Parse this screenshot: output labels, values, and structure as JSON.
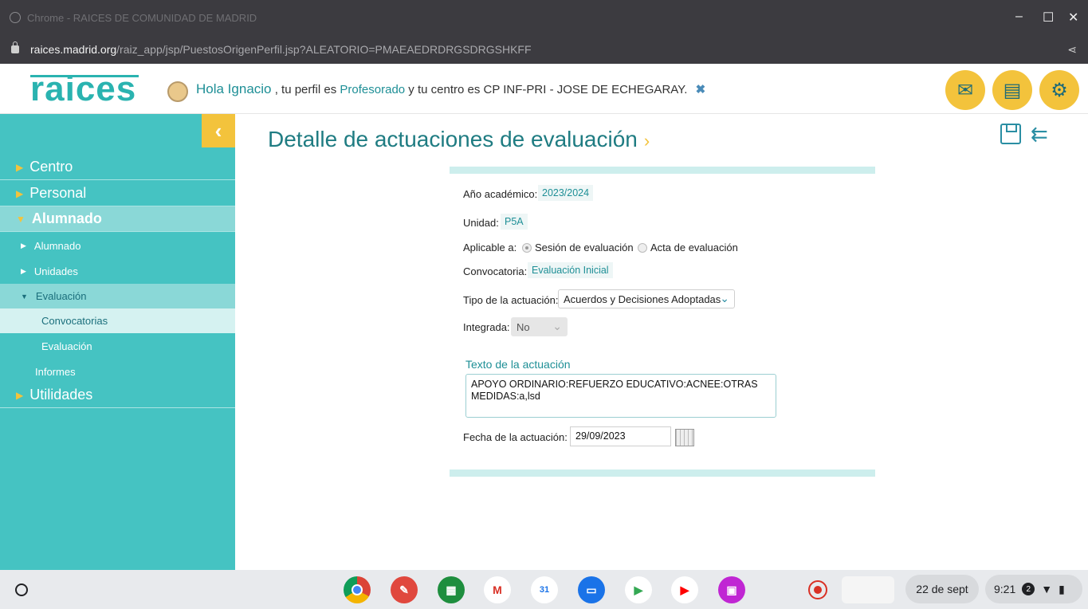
{
  "window": {
    "title": "Chrome - RAICES DE COMUNIDAD DE MADRID",
    "minimize": "–",
    "maximize": "☐",
    "close": "✕"
  },
  "browser": {
    "url_host": "raices.madrid.org",
    "url_path": "/raiz_app/jsp/PuestosOrigenPerfil.jsp?ALEATORIO=PMAEAEDRDRGSDRGSHKFF"
  },
  "header": {
    "logo": "raices",
    "greeting_hola": "Hola Ignacio",
    "greeting_mid": ", tu perfil es",
    "profile": "Profesorado",
    "greeting_centre_prefix": "y tu centro es",
    "centre": "CP INF-PRI - JOSE DE ECHEGARAY.",
    "close_symbol": "✖"
  },
  "sidebar": {
    "collapse_symbol": "‹",
    "items": [
      {
        "label": "Centro"
      },
      {
        "label": "Personal"
      },
      {
        "label": "Alumnado"
      },
      {
        "label": "Alumnado"
      },
      {
        "label": "Unidades"
      },
      {
        "label": "Evaluación"
      },
      {
        "label": "Convocatorias"
      },
      {
        "label": "Evaluación"
      },
      {
        "label": "Informes"
      },
      {
        "label": "Utilidades"
      }
    ]
  },
  "main": {
    "title": "Detalle de actuaciones de evaluación",
    "fields": {
      "anio_label": "Año académico:",
      "anio_value": "2023/2024",
      "unidad_label": "Unidad:",
      "unidad_value": "P5A",
      "aplicable_label": "Aplicable a:",
      "aplicable_opt1": "Sesión de evaluación",
      "aplicable_opt2": "Acta de evaluación",
      "convocatoria_label": "Convocatoria:",
      "convocatoria_value": "Evaluación Inicial",
      "tipo_label": "Tipo de la actuación:",
      "tipo_value": "Acuerdos y Decisiones Adoptadas",
      "integrada_label": "Integrada:",
      "integrada_value": "No",
      "texto_label": "Texto de la actuación",
      "texto_value": "APOYO ORDINARIO:REFUERZO EDUCATIVO:ACNEE:OTRAS MEDIDAS:a,lsd",
      "fecha_label": "Fecha de la actuación:",
      "fecha_value": "29/09/2023"
    }
  },
  "shelf": {
    "date": "22 de sept",
    "time": "9:21",
    "notif_count": "2",
    "apps": [
      "Chrome",
      "Canvas",
      "Classroom",
      "Gmail",
      "Calendar",
      "Files",
      "Play Store",
      "YouTube",
      "Screencast"
    ]
  }
}
